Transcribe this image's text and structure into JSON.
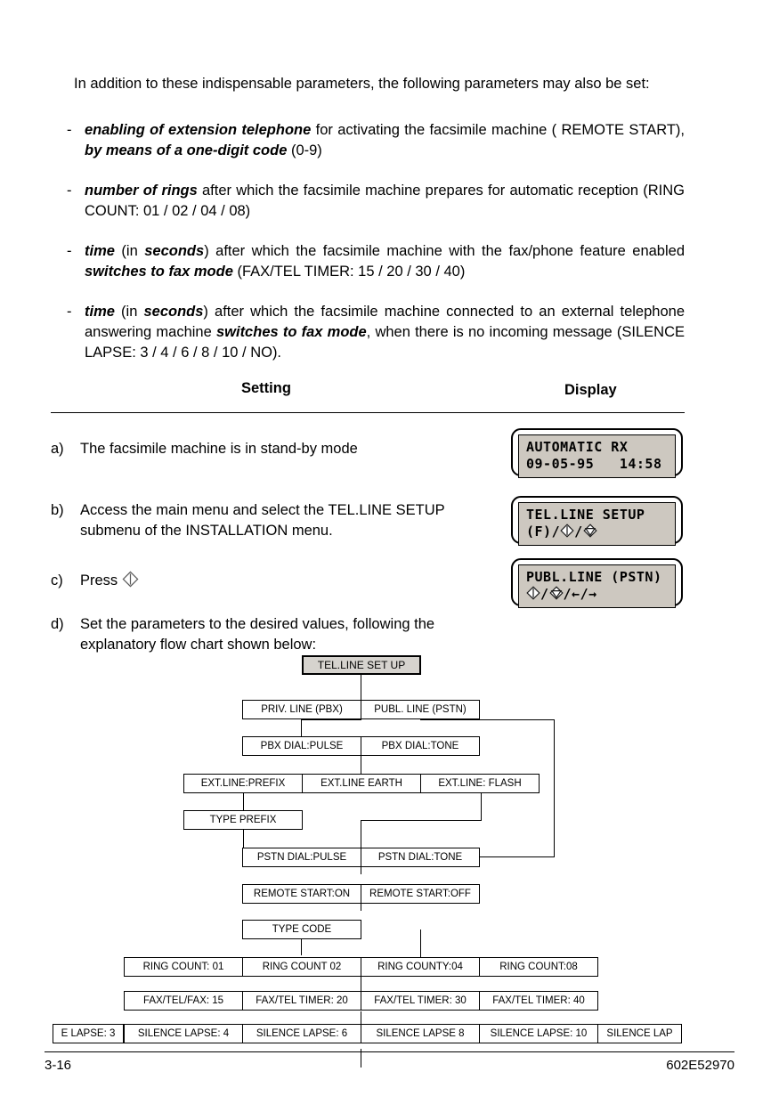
{
  "intro": {
    "text": "In addition to these indispensable parameters, the following parameters may also be set:"
  },
  "bullets": [
    {
      "dash": "-",
      "parts": [
        {
          "t": "enabling of extension telephone",
          "b": true
        },
        {
          "t": " for activating the facsimile machine ( REMOTE START), ",
          "b": false
        },
        {
          "t": "by means of a one-digit code",
          "b": true
        },
        {
          "t": " (0-9)",
          "b": false
        }
      ]
    },
    {
      "dash": "-",
      "parts": [
        {
          "t": "number of rings",
          "b": true
        },
        {
          "t": " after which the facsimile machine prepares for automatic reception (RING COUNT: 01 / 02 / 04 / 08)",
          "b": false
        }
      ]
    },
    {
      "dash": "-",
      "parts": [
        {
          "t": "time",
          "b": true
        },
        {
          "t": " (in ",
          "b": false
        },
        {
          "t": "seconds",
          "b": true
        },
        {
          "t": ") after which the facsimile machine with the fax/phone feature enabled ",
          "b": false
        },
        {
          "t": "switches to fax mode",
          "b": true
        },
        {
          "t": " (FAX/TEL TIMER: 15 / 20 / 30 / 40)",
          "b": false
        }
      ]
    },
    {
      "dash": "-",
      "parts": [
        {
          "t": "time",
          "b": true
        },
        {
          "t": " (in ",
          "b": false
        },
        {
          "t": "seconds",
          "b": true
        },
        {
          "t": ") after which the facsimile machine connected to an external telephone answering machine ",
          "b": false
        },
        {
          "t": "switches to fax mode",
          "b": true
        },
        {
          "t": ", when there is no incoming message (SILENCE LAPSE: 3 / 4 / 6 / 8 / 10 / NO).",
          "b": false
        }
      ]
    }
  ],
  "columns": {
    "setting": "Setting",
    "display": "Display"
  },
  "steps": {
    "a": {
      "marker": "a)",
      "text": "The facsimile machine is in stand-by mode"
    },
    "b": {
      "marker": "b)",
      "text": "Access the main menu and select the TEL.LINE SETUP submenu of the INSTALLATION  menu."
    },
    "c": {
      "marker": "c)",
      "text": "Press "
    },
    "d": {
      "marker": "d)",
      "text": "Set the parameters to the desired values, following the explanatory flow chart shown below:"
    }
  },
  "displays": [
    {
      "line1": "AUTOMATIC RX",
      "line2": "09-05-95   14:58",
      "line2_glyphs": []
    },
    {
      "line1": "TEL.LINE SETUP",
      "line2_prefix": "(F)/",
      "line2_mid": "/",
      "line2_suffix": "",
      "glyph1": "diamond-up-key-icon",
      "glyph2": "diamond-down-key-icon"
    },
    {
      "line1": "PUBL.LINE (PSTN)",
      "line2_prefix": "",
      "line2_mid": "/",
      "line2_suffix": "/←/→",
      "glyph1": "diamond-up-key-icon",
      "glyph2": "diamond-down-key-icon"
    }
  ],
  "flowchart": {
    "root": "TEL.LINE SET UP",
    "rows": [
      {
        "name": "line-type",
        "boxes": [
          "PRIV. LINE (PBX)",
          "PUBL. LINE (PSTN)"
        ]
      },
      {
        "name": "pbx-dial",
        "boxes": [
          "PBX DIAL:PULSE",
          "PBX DIAL:TONE"
        ]
      },
      {
        "name": "ext-line",
        "boxes": [
          "EXT.LINE:PREFIX",
          "EXT.LINE EARTH",
          "EXT.LINE: FLASH"
        ]
      },
      {
        "name": "type-prefix",
        "boxes": [
          "TYPE PREFIX"
        ]
      },
      {
        "name": "pstn-dial",
        "boxes": [
          "PSTN DIAL:PULSE",
          "PSTN DIAL:TONE"
        ]
      },
      {
        "name": "remote-start",
        "boxes": [
          "REMOTE START:ON",
          "REMOTE START:OFF"
        ]
      },
      {
        "name": "type-code",
        "boxes": [
          "TYPE CODE"
        ]
      },
      {
        "name": "ring-count",
        "boxes": [
          "RING COUNT: 01",
          "RING COUNT 02",
          "RING COUNTY:04",
          "RING COUNT:08"
        ]
      },
      {
        "name": "fax-tel-timer",
        "boxes": [
          "FAX/TEL/FAX: 15",
          "FAX/TEL TIMER: 20",
          "FAX/TEL TIMER: 30",
          "FAX/TEL TIMER: 40"
        ]
      },
      {
        "name": "silence-lapse",
        "boxes": [
          "E LAPSE: 3",
          "SILENCE LAPSE: 4",
          "SILENCE LAPSE: 6",
          "SILENCE LAPSE 8",
          "SILENCE LAPSE: 10",
          "SILENCE LAP"
        ]
      }
    ]
  },
  "footer": {
    "page_number": "3-16",
    "document_code": "602E52970"
  },
  "colors": {
    "shaded_box": "#d6d3ce",
    "lcd_screen": "#cdc8c0",
    "ink": "#000000"
  }
}
